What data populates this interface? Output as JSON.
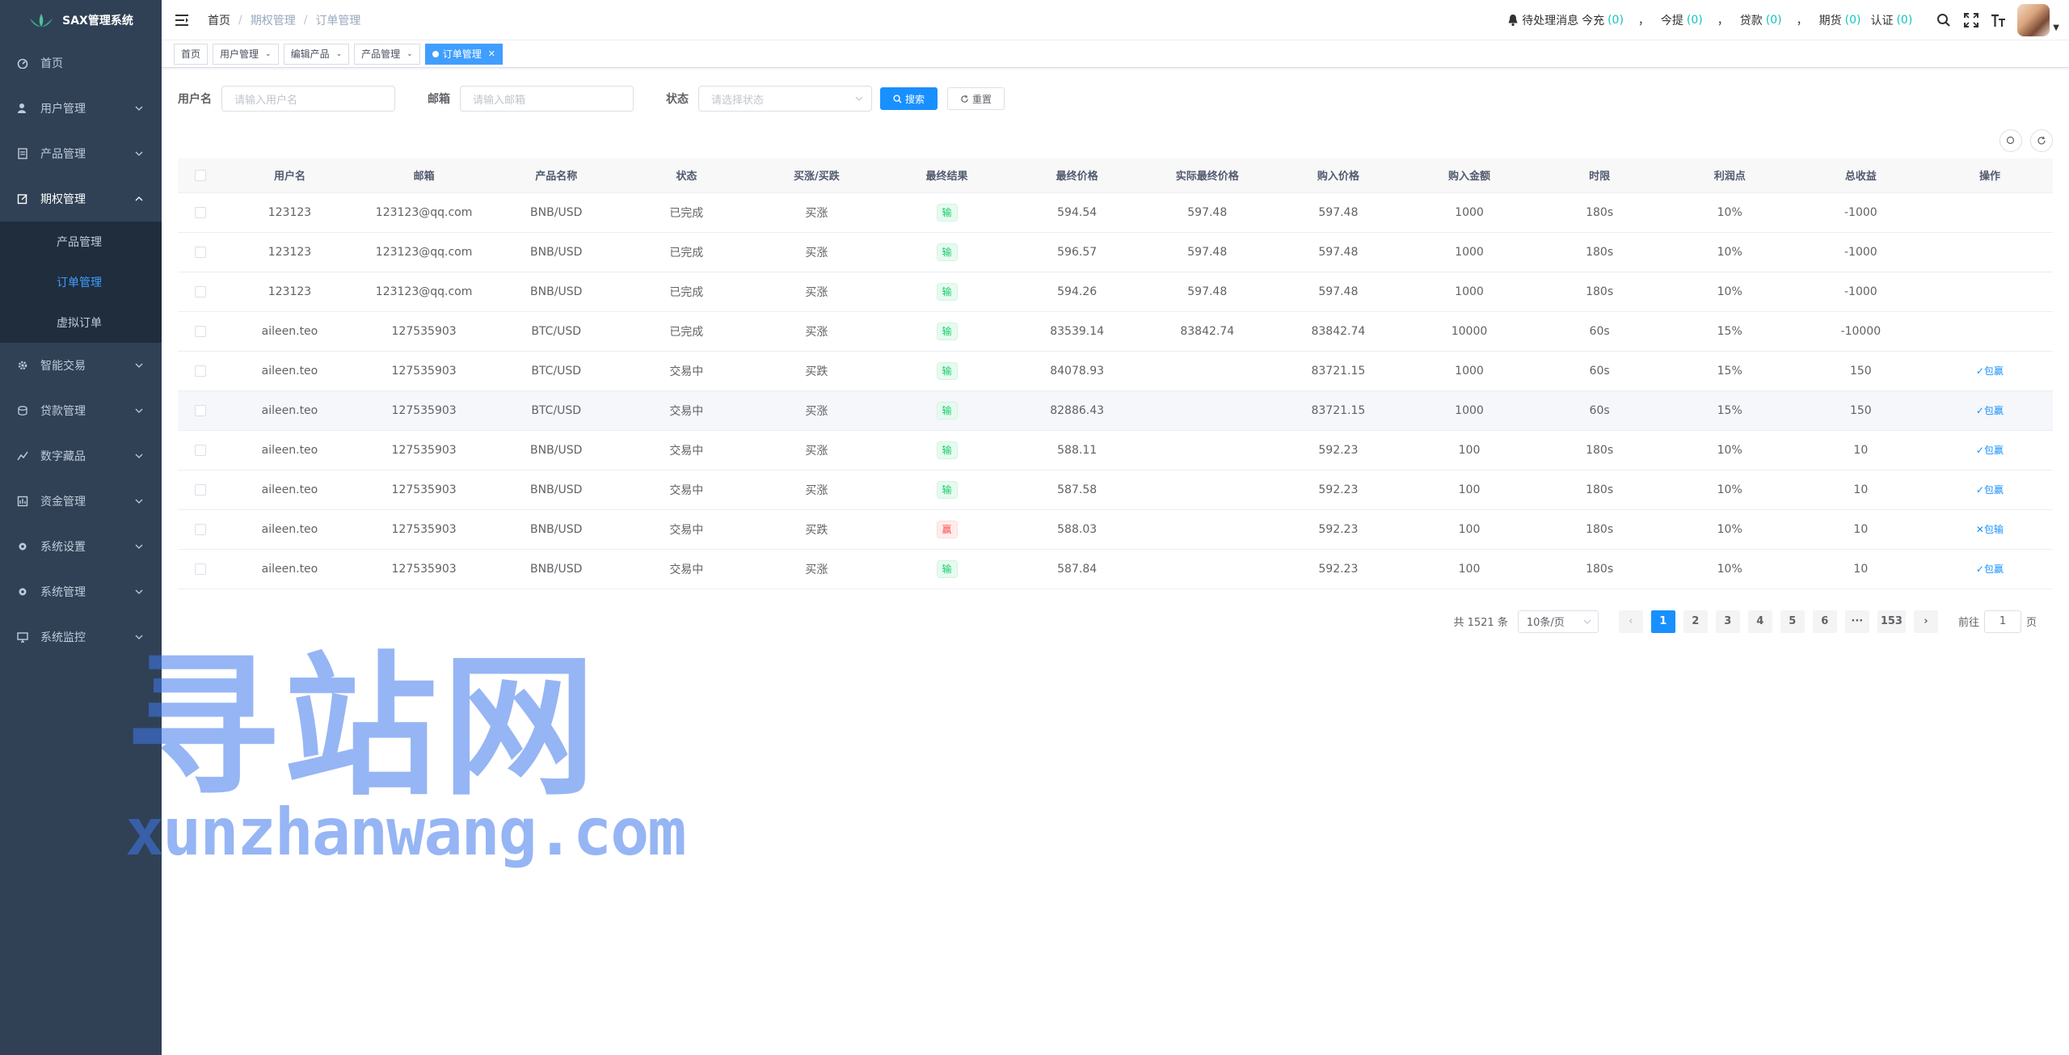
{
  "app": {
    "title": "SAX管理系统"
  },
  "sidebar": {
    "items": [
      {
        "label": "首页",
        "icon": "dashboard-icon"
      },
      {
        "label": "用户管理",
        "icon": "user-icon"
      },
      {
        "label": "产品管理",
        "icon": "document-icon"
      },
      {
        "label": "期权管理",
        "icon": "edit-icon"
      },
      {
        "label": "智能交易",
        "icon": "gear-icon"
      },
      {
        "label": "贷款管理",
        "icon": "coins-icon"
      },
      {
        "label": "数字藏品",
        "icon": "chart-icon"
      },
      {
        "label": "资金管理",
        "icon": "money-icon"
      },
      {
        "label": "系统设置",
        "icon": "gear-icon"
      },
      {
        "label": "系统管理",
        "icon": "gear-icon"
      },
      {
        "label": "系统监控",
        "icon": "monitor-icon"
      }
    ],
    "submenu": [
      {
        "label": "产品管理"
      },
      {
        "label": "订单管理"
      },
      {
        "label": "虚拟订单"
      }
    ]
  },
  "breadcrumb": [
    "首页",
    "期权管理",
    "订单管理"
  ],
  "header": {
    "pending_label": "待处理消息",
    "items": [
      {
        "label": "今充",
        "count": "(0)"
      },
      {
        "label": "今提",
        "count": "(0)"
      },
      {
        "label": "贷款",
        "count": "(0)"
      },
      {
        "label": "期货",
        "count": "(0)"
      },
      {
        "label": "认证",
        "count": "(0)"
      }
    ],
    "comma": "，"
  },
  "tags": [
    {
      "label": "首页"
    },
    {
      "label": "用户管理"
    },
    {
      "label": "编辑产品"
    },
    {
      "label": "产品管理"
    },
    {
      "label": "订单管理"
    }
  ],
  "form": {
    "username_label": "用户名",
    "username_placeholder": "请输入用户名",
    "email_label": "邮箱",
    "email_placeholder": "请输入邮箱",
    "status_label": "状态",
    "status_placeholder": "请选择状态",
    "search_label": "搜索",
    "reset_label": "重置"
  },
  "table": {
    "headers": [
      "用户名",
      "邮箱",
      "产品名称",
      "状态",
      "买涨/买跌",
      "最终结果",
      "最终价格",
      "实际最终价格",
      "购入价格",
      "购入金额",
      "时限",
      "利润点",
      "总收益",
      "操作"
    ],
    "rows": [
      {
        "user": "123123",
        "email": "123123@qq.com",
        "product": "BNB/USD",
        "status": "已完成",
        "direction": "买涨",
        "result": "输",
        "final_price": "594.54",
        "actual_price": "597.48",
        "buy_price": "597.48",
        "amount": "1000",
        "period": "180s",
        "profit": "10%",
        "total": "-1000",
        "op": ""
      },
      {
        "user": "123123",
        "email": "123123@qq.com",
        "product": "BNB/USD",
        "status": "已完成",
        "direction": "买涨",
        "result": "输",
        "final_price": "596.57",
        "actual_price": "597.48",
        "buy_price": "597.48",
        "amount": "1000",
        "period": "180s",
        "profit": "10%",
        "total": "-1000",
        "op": ""
      },
      {
        "user": "123123",
        "email": "123123@qq.com",
        "product": "BNB/USD",
        "status": "已完成",
        "direction": "买涨",
        "result": "输",
        "final_price": "594.26",
        "actual_price": "597.48",
        "buy_price": "597.48",
        "amount": "1000",
        "period": "180s",
        "profit": "10%",
        "total": "-1000",
        "op": ""
      },
      {
        "user": "aileen.teo",
        "email": "127535903",
        "product": "BTC/USD",
        "status": "已完成",
        "direction": "买涨",
        "result": "输",
        "final_price": "83539.14",
        "actual_price": "83842.74",
        "buy_price": "83842.74",
        "amount": "10000",
        "period": "60s",
        "profit": "15%",
        "total": "-10000",
        "op": ""
      },
      {
        "user": "aileen.teo",
        "email": "127535903",
        "product": "BTC/USD",
        "status": "交易中",
        "direction": "买跌",
        "result": "输",
        "final_price": "84078.93",
        "actual_price": "",
        "buy_price": "83721.15",
        "amount": "1000",
        "period": "60s",
        "profit": "15%",
        "total": "150",
        "op": "✓包赢"
      },
      {
        "user": "aileen.teo",
        "email": "127535903",
        "product": "BTC/USD",
        "status": "交易中",
        "direction": "买涨",
        "result": "输",
        "final_price": "82886.43",
        "actual_price": "",
        "buy_price": "83721.15",
        "amount": "1000",
        "period": "60s",
        "profit": "15%",
        "total": "150",
        "op": "✓包赢"
      },
      {
        "user": "aileen.teo",
        "email": "127535903",
        "product": "BNB/USD",
        "status": "交易中",
        "direction": "买涨",
        "result": "输",
        "final_price": "588.11",
        "actual_price": "",
        "buy_price": "592.23",
        "amount": "100",
        "period": "180s",
        "profit": "10%",
        "total": "10",
        "op": "✓包赢"
      },
      {
        "user": "aileen.teo",
        "email": "127535903",
        "product": "BNB/USD",
        "status": "交易中",
        "direction": "买涨",
        "result": "输",
        "final_price": "587.58",
        "actual_price": "",
        "buy_price": "592.23",
        "amount": "100",
        "period": "180s",
        "profit": "10%",
        "total": "10",
        "op": "✓包赢"
      },
      {
        "user": "aileen.teo",
        "email": "127535903",
        "product": "BNB/USD",
        "status": "交易中",
        "direction": "买跌",
        "result": "赢",
        "final_price": "588.03",
        "actual_price": "",
        "buy_price": "592.23",
        "amount": "100",
        "period": "180s",
        "profit": "10%",
        "total": "10",
        "op": "✕包输"
      },
      {
        "user": "aileen.teo",
        "email": "127535903",
        "product": "BNB/USD",
        "status": "交易中",
        "direction": "买涨",
        "result": "输",
        "final_price": "587.84",
        "actual_price": "",
        "buy_price": "592.23",
        "amount": "100",
        "period": "180s",
        "profit": "10%",
        "total": "10",
        "op": "✓包赢"
      }
    ]
  },
  "pagination": {
    "total": "共 1521 条",
    "page_size": "10条/页",
    "pages": [
      "1",
      "2",
      "3",
      "4",
      "5",
      "6",
      "···",
      "153"
    ],
    "goto_prefix": "前往",
    "goto_value": "1",
    "goto_suffix": "页"
  },
  "watermark": {
    "big": "寻站网",
    "small": "xunzhanwang.com"
  },
  "colors": {
    "sidebar": "#304156",
    "accent": "#1890ff",
    "win": "#13ce66",
    "lose": "#ff4949"
  }
}
